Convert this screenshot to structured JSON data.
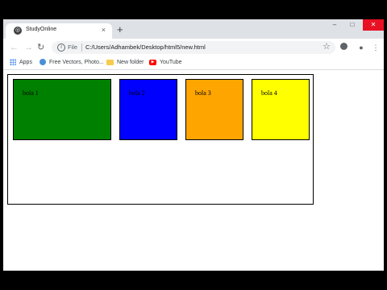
{
  "browser": {
    "tab_title": "StudyOnline",
    "tab_close": "×",
    "new_tab": "+",
    "scheme_label": "File",
    "url": "C:/Users/Adhambek/Desktop/html5/new.html",
    "window_controls": {
      "minimize": "–",
      "maximize": "□",
      "close": "✕"
    },
    "nav": {
      "back": "←",
      "forward": "→",
      "reload": "↻"
    },
    "star": "☆",
    "menu": "⋮"
  },
  "bookmarks": [
    {
      "label": "Apps",
      "icon": "apps-grid-icon"
    },
    {
      "label": "Free Vectors, Photo...",
      "icon": "globe-icon"
    },
    {
      "label": "New folder",
      "icon": "folder-icon"
    },
    {
      "label": "YouTube",
      "icon": "youtube-icon"
    }
  ],
  "page": {
    "boxes": [
      {
        "label": "bola 1",
        "color": "#008000"
      },
      {
        "label": "bola 2",
        "color": "#0000ff"
      },
      {
        "label": "bola 3",
        "color": "#ffa500"
      },
      {
        "label": "bola 4",
        "color": "#ffff00"
      }
    ]
  }
}
